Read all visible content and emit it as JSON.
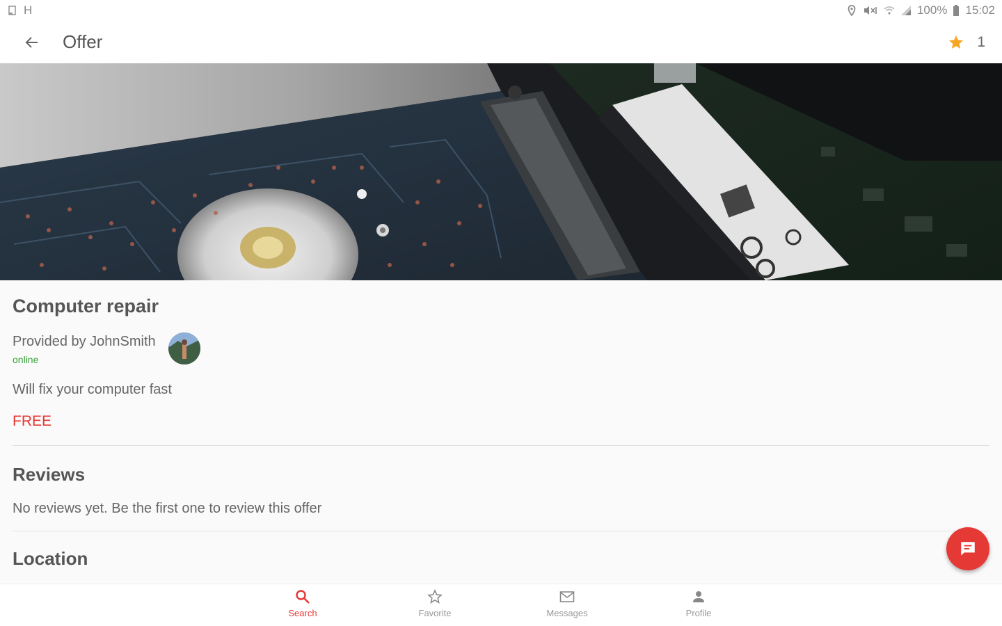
{
  "status_bar": {
    "left_icons": [
      "notification-icon",
      "h-icon"
    ],
    "h_text": "H",
    "battery": "100%",
    "time": "15:02"
  },
  "app_bar": {
    "title": "Offer",
    "favorite_count": "1"
  },
  "offer": {
    "title": "Computer repair",
    "provider": "Provided by JohnSmith",
    "provider_status": "online",
    "description": "Will fix your computer fast",
    "price": "FREE"
  },
  "reviews": {
    "title": "Reviews",
    "empty_text": "No reviews yet. Be the first one to review this offer"
  },
  "location": {
    "title": "Location"
  },
  "bottom_nav": {
    "items": [
      {
        "label": "Search",
        "icon": "search-icon",
        "active": true
      },
      {
        "label": "Favorite",
        "icon": "star-outline-icon",
        "active": false
      },
      {
        "label": "Messages",
        "icon": "mail-icon",
        "active": false
      },
      {
        "label": "Profile",
        "icon": "person-icon",
        "active": false
      }
    ]
  },
  "colors": {
    "accent": "#e53935",
    "star": "#f5a623",
    "online": "#3aa13a"
  }
}
